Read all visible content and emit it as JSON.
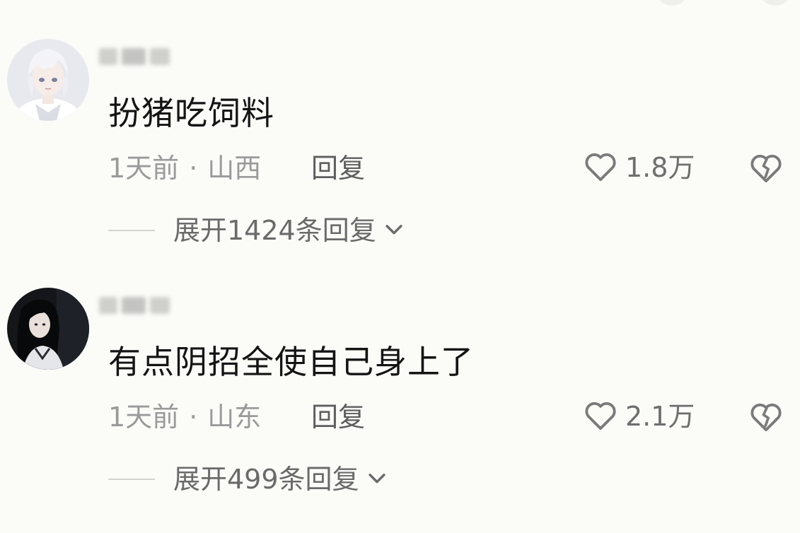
{
  "comments": [
    {
      "username": "",
      "text": "扮猪吃饲料",
      "time": "1天前",
      "separator": "·",
      "location": "山西",
      "reply_label": "回复",
      "likes": "1.8万",
      "expand_label": "展开1424条回复",
      "avatar": "anime-white-hair-avatar"
    },
    {
      "username": "",
      "text": "有点阴招全使自己身上了",
      "time": "1天前",
      "separator": "·",
      "location": "山东",
      "reply_label": "回复",
      "likes": "2.1万",
      "expand_label": "展开499条回复",
      "avatar": "dark-hair-girl-avatar"
    }
  ],
  "icons": {
    "like": "heart-outline-icon",
    "dislike": "broken-heart-icon",
    "expand": "chevron-down-icon"
  },
  "colors": {
    "background": "#fbfbf8",
    "text_primary": "#141414",
    "text_meta": "#9a9a9a",
    "text_secondary": "#6a6a6a"
  }
}
